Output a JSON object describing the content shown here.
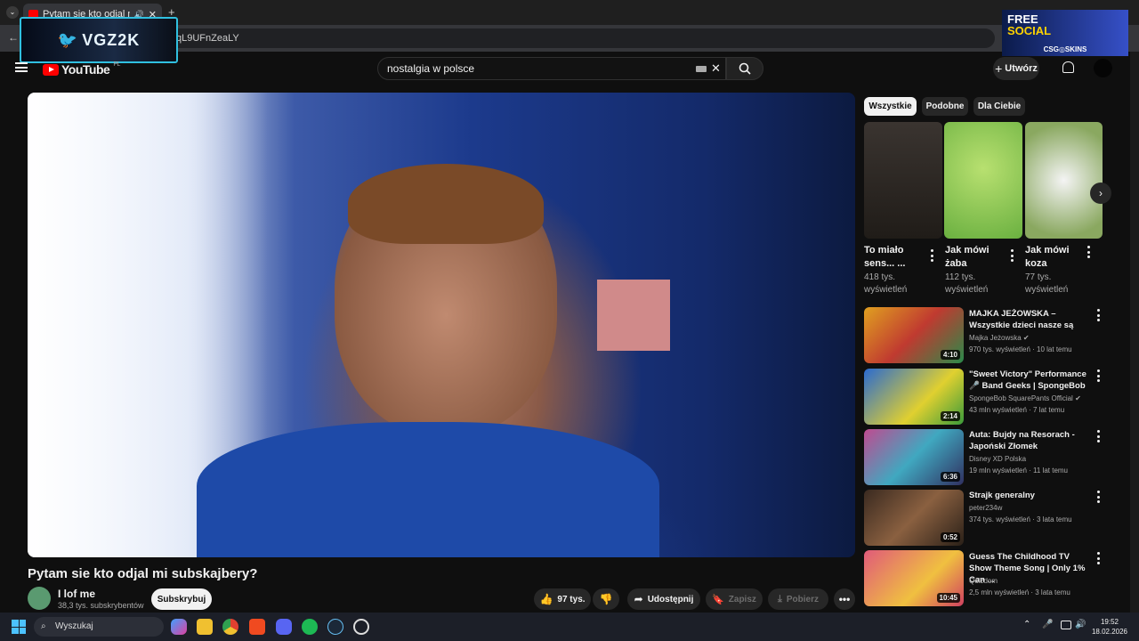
{
  "browser": {
    "tab_title": "Pytam sie kto odjal mi subskajbery?",
    "url_fragment": "qL9UFnZeaLY"
  },
  "overlays": {
    "stream_logo": "VGZ2K",
    "promo_line1": "FREE",
    "promo_line2": "SOCIAL",
    "promo_footer": "CSG◎SKINS"
  },
  "youtube": {
    "logo_text": "YouTube",
    "logo_region": "PL",
    "search_value": "nostalgia w polsce",
    "create_label": "Utwórz"
  },
  "video": {
    "title": "Pytam sie kto odjal mi subskajbery?",
    "channel": "I lof me",
    "subscribers": "38,3 tys. subskrybentów",
    "subscribe_label": "Subskrybuj",
    "likes": "97 tys.",
    "share_label": "Udostępnij",
    "save_label": "Zapisz",
    "download_label": "Pobierz"
  },
  "sidebar": {
    "chips": [
      "Wszystkie",
      "Podobne",
      "Dla Ciebie"
    ],
    "shorts": [
      {
        "title": "To miało sens... ...",
        "views": "418 tys. wyświetleń"
      },
      {
        "title": "Jak mówi żaba",
        "views": "112 tys. wyświetleń"
      },
      {
        "title": "Jak mówi koza",
        "views": "77 tys. wyświetleń"
      }
    ],
    "videos": [
      {
        "title": "MAJKA JEŻOWSKA – Wszystkie dzieci nasze są",
        "channel": "Majka Jeżowska",
        "meta": "970 tys. wyświetleń · 10 lat temu",
        "duration": "4:10",
        "verified": true,
        "color": "#c0402a"
      },
      {
        "title": "\"Sweet Victory\" Performance 🎤 Band Geeks | SpongeBob",
        "channel": "SpongeBob SquarePants Official",
        "meta": "43 mln wyświetleń · 7 lat temu",
        "duration": "2:14",
        "verified": true,
        "color": "#3a7ad0"
      },
      {
        "title": "Auta: Bujdy na Resorach - Japoński Złomek",
        "channel": "Disney XD Polska",
        "meta": "19 mln wyświetleń · 11 lat temu",
        "duration": "6:36",
        "verified": false,
        "color": "#3a88b0"
      },
      {
        "title": "Strajk generalny",
        "channel": "peter234w",
        "meta": "374 tys. wyświetleń · 3 lata temu",
        "duration": "0:52",
        "verified": false,
        "color": "#5a4030"
      },
      {
        "title": "Guess The Childhood TV Show Theme Song | Only 1% Can ...",
        "channel": "Quizdom",
        "meta": "2,5 mln wyświetleń · 3 lata temu",
        "duration": "10:45",
        "verified": false,
        "color": "#d04a6a"
      }
    ]
  },
  "taskbar": {
    "search_placeholder": "Wyszukaj",
    "time": "19:52",
    "date": "18.02.2026"
  }
}
